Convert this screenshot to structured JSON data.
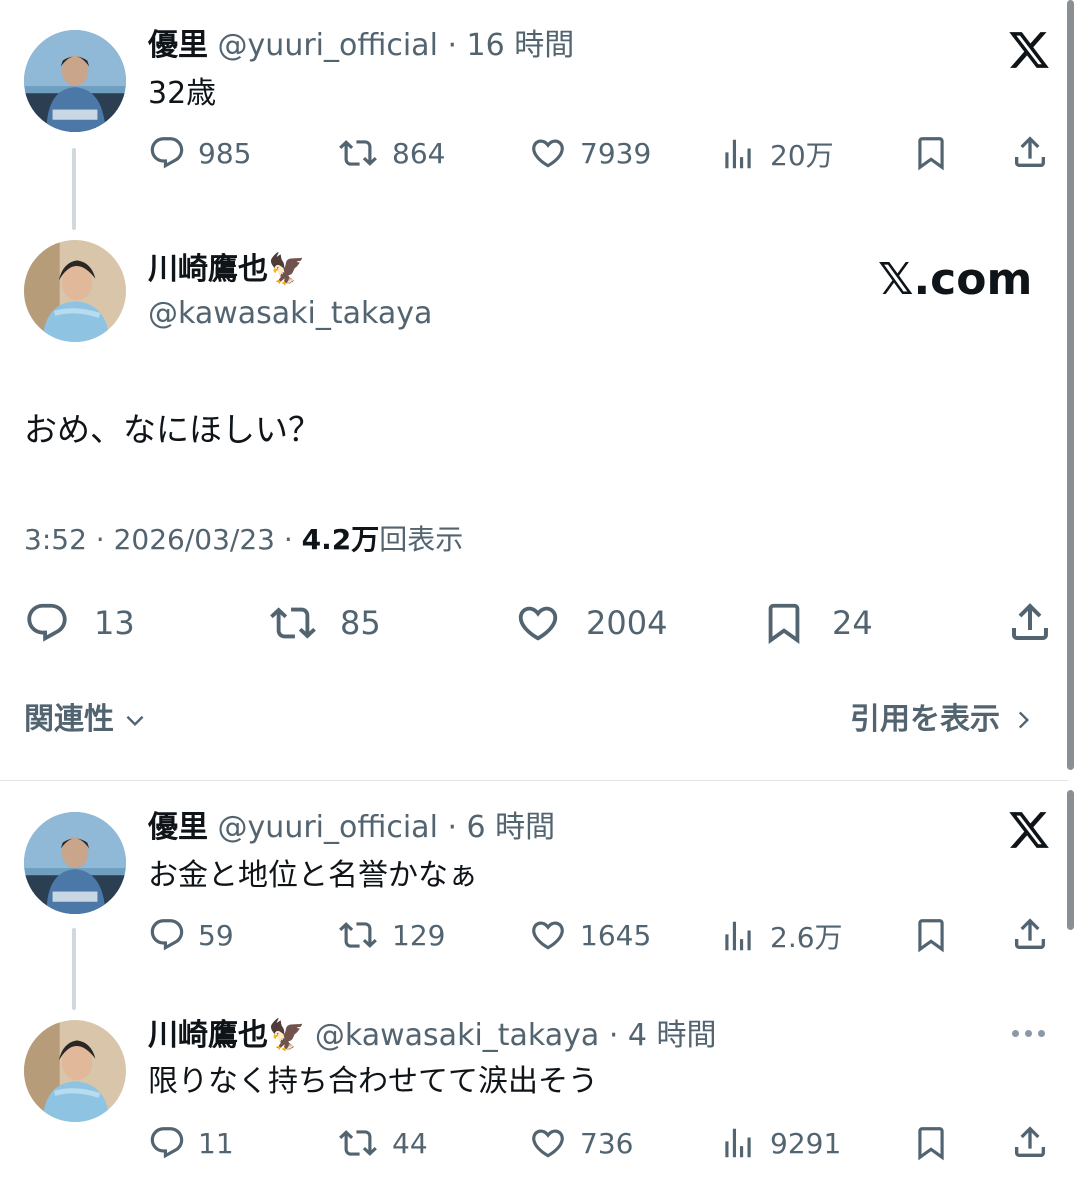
{
  "thread_top": {
    "tweet1": {
      "name": "優里",
      "handle": "@yuuri_official",
      "time": "· 16 時間",
      "text": "32歳",
      "stats": {
        "replies": "985",
        "retweets": "864",
        "likes": "7939",
        "views": "20万"
      }
    },
    "main": {
      "name": "川崎鷹也",
      "name_emoji": "🦅",
      "handle": "@kawasaki_takaya",
      "text": "おめ、なにほしい？",
      "timestamp": "3:52 · 2026/03/23 ·",
      "views_count": "4.2万",
      "views_label": "回表示",
      "stats": {
        "replies": "13",
        "retweets": "85",
        "likes": "2004",
        "bookmarks": "24"
      },
      "watermark": "𝕏.com"
    },
    "sort_label": "関連性",
    "quote_link": "引用を表示"
  },
  "thread_bottom": {
    "tweet1": {
      "name": "優里",
      "handle": "@yuuri_official",
      "time": "· 6 時間",
      "text": "お金と地位と名誉かなぁ",
      "stats": {
        "replies": "59",
        "retweets": "129",
        "likes": "1645",
        "views": "2.6万"
      }
    },
    "tweet2": {
      "name": "川崎鷹也",
      "name_emoji": "🦅",
      "handle": "@kawasaki_takaya",
      "time": "· 4 時間",
      "text": "限りなく持ち合わせてて涙出そう",
      "stats": {
        "replies": "11",
        "retweets": "44",
        "likes": "736",
        "views": "9291"
      }
    }
  },
  "colors": {
    "text": "#0f1419",
    "muted": "#536471",
    "line": "#cfd9de"
  }
}
